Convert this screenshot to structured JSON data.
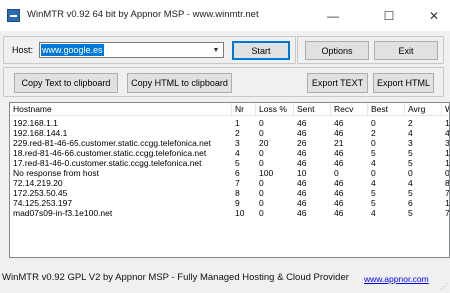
{
  "window": {
    "title": "WinMTR v0.92 64 bit by Appnor MSP - www.winmtr.net",
    "minimize_glyph": "—",
    "maximize_glyph": "☐",
    "close_glyph": "✕"
  },
  "host": {
    "label": "Host:",
    "value": "www.google.es",
    "dropdown_glyph": "▼"
  },
  "buttons": {
    "start": "Start",
    "options": "Options",
    "exit": "Exit",
    "copy_text": "Copy Text to clipboard",
    "copy_html": "Copy HTML to clipboard",
    "export_text": "Export TEXT",
    "export_html": "Export HTML"
  },
  "table": {
    "columns": [
      "Hostname",
      "Nr",
      "Loss %",
      "Sent",
      "Recv",
      "Best",
      "Avrg",
      "W"
    ],
    "rows": [
      [
        "192.168.1.1",
        "1",
        "0",
        "46",
        "46",
        "0",
        "2",
        "1"
      ],
      [
        "192.168.144.1",
        "2",
        "0",
        "46",
        "46",
        "2",
        "4",
        "4"
      ],
      [
        "229.red-81-46-65.customer.static.ccgg.telefonica.net",
        "3",
        "20",
        "26",
        "21",
        "0",
        "3",
        "3"
      ],
      [
        "18.red-81-46-66.customer.static.ccgg.telefonica.net",
        "4",
        "0",
        "46",
        "46",
        "5",
        "5",
        "1"
      ],
      [
        "17.red-81-46-0.customer.static.ccgg.telefonica.net",
        "5",
        "0",
        "46",
        "46",
        "4",
        "5",
        "1"
      ],
      [
        "No response from host",
        "6",
        "100",
        "10",
        "0",
        "0",
        "0",
        "0"
      ],
      [
        "72.14.219.20",
        "7",
        "0",
        "46",
        "46",
        "4",
        "4",
        "8"
      ],
      [
        "172.253.50.45",
        "8",
        "0",
        "46",
        "46",
        "5",
        "5",
        "7"
      ],
      [
        "74.125.253.197",
        "9",
        "0",
        "46",
        "46",
        "5",
        "6",
        "1"
      ],
      [
        "mad07s09-in-f3.1e100.net",
        "10",
        "0",
        "46",
        "46",
        "4",
        "5",
        "7"
      ]
    ]
  },
  "statusbar": {
    "text": "WinMTR v0.92 GPL V2 by Appnor MSP - Fully Managed Hosting & Cloud Provider",
    "link": "www.appnor.com"
  }
}
